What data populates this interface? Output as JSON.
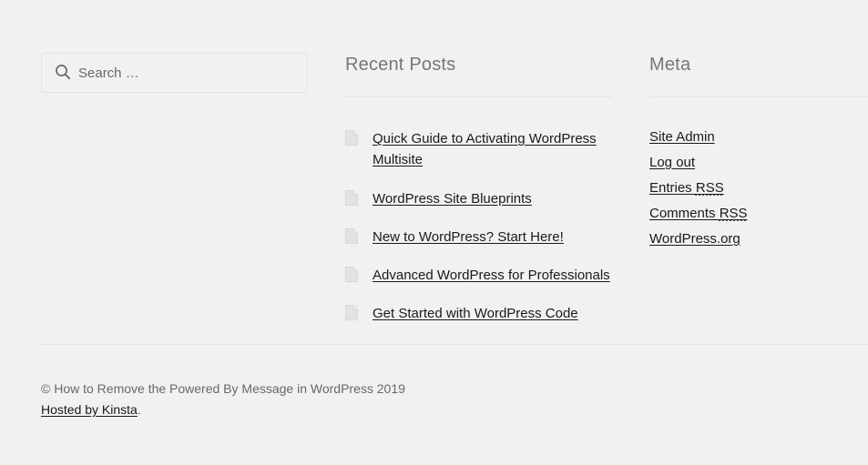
{
  "colors": {
    "background": "#f1f1f1",
    "heading": "#767676",
    "body_text": "#404040",
    "link": "#1a1a1a",
    "muted_text": "#686868",
    "divider": "#e4e4e4",
    "input_border": "#e2e2e2",
    "icon": "#d5d5d5"
  },
  "search": {
    "placeholder": "Search …",
    "value": "",
    "icon": "search-icon"
  },
  "recent_posts": {
    "title": "Recent Posts",
    "item_icon": "document-icon",
    "items": [
      {
        "label": "Quick Guide to Activating WordPress Multisite"
      },
      {
        "label": "WordPress Site Blueprints"
      },
      {
        "label": "New to WordPress? Start Here!"
      },
      {
        "label": "Advanced WordPress for Professionals"
      },
      {
        "label": "Get Started with WordPress Code"
      }
    ]
  },
  "meta": {
    "title": "Meta",
    "items": [
      {
        "label": "Site Admin",
        "abbr": ""
      },
      {
        "label": "Log out",
        "abbr": ""
      },
      {
        "label": "Entries ",
        "abbr": "RSS"
      },
      {
        "label": "Comments ",
        "abbr": "RSS"
      },
      {
        "label": "WordPress.org",
        "abbr": ""
      }
    ]
  },
  "footer": {
    "copyright": "© How to Remove the Powered By Message in WordPress 2019",
    "host_link": "Hosted by Kinsta",
    "host_suffix": "."
  }
}
